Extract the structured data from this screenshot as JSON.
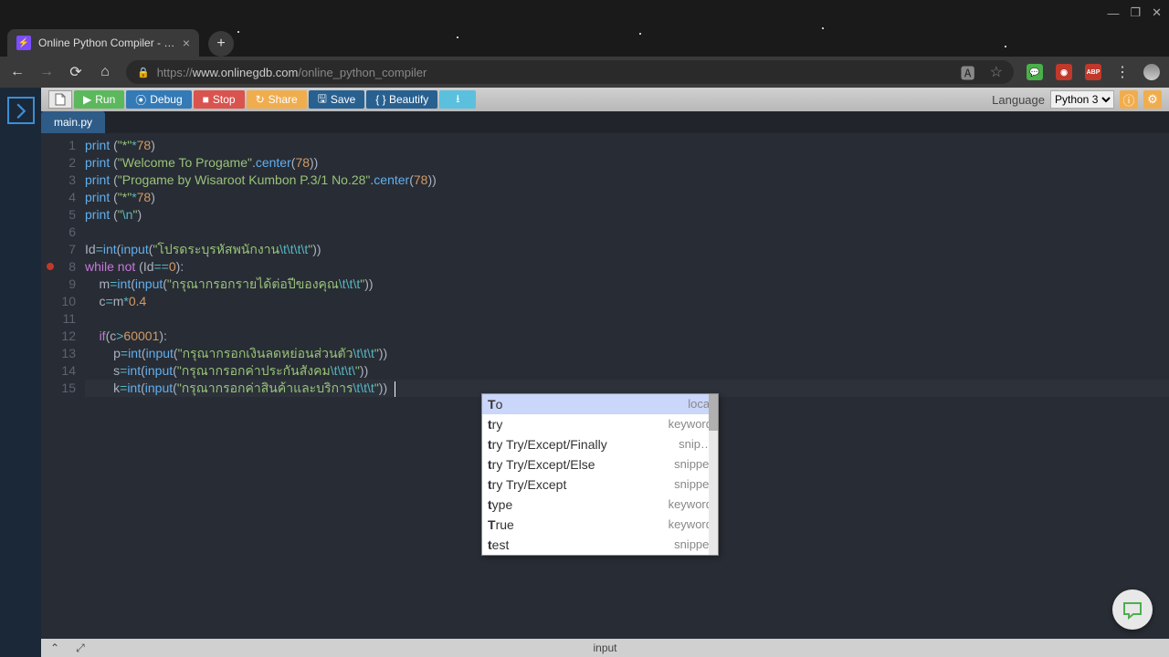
{
  "browser": {
    "tab_title": "Online Python Compiler - online…",
    "url_scheme": "https://",
    "url_host": "www.onlinegdb.com",
    "url_path": "/online_python_compiler"
  },
  "toolbar": {
    "file_icon": "▢",
    "run": "Run",
    "debug": "Debug",
    "stop": "Stop",
    "share": "Share",
    "save": "Save",
    "beautify": "{ } Beautify",
    "language_label": "Language",
    "language_value": "Python 3"
  },
  "filetab": "main.py",
  "code": {
    "lines": [
      [
        [
          "fn",
          "print"
        ],
        [
          "id",
          " ("
        ],
        [
          "str",
          "\"*\""
        ],
        [
          "op",
          "*"
        ],
        [
          "num",
          "78"
        ],
        [
          "id",
          ")"
        ]
      ],
      [
        [
          "fn",
          "print"
        ],
        [
          "id",
          " ("
        ],
        [
          "str",
          "\"Welcome To Progame\""
        ],
        [
          "id",
          "."
        ],
        [
          "fn",
          "center"
        ],
        [
          "id",
          "("
        ],
        [
          "num",
          "78"
        ],
        [
          "id",
          "))"
        ]
      ],
      [
        [
          "fn",
          "print"
        ],
        [
          "id",
          " ("
        ],
        [
          "str",
          "\"Progame by Wisaroot Kumbon P.3/1 No.28\""
        ],
        [
          "id",
          "."
        ],
        [
          "fn",
          "center"
        ],
        [
          "id",
          "("
        ],
        [
          "num",
          "78"
        ],
        [
          "id",
          "))"
        ]
      ],
      [
        [
          "fn",
          "print"
        ],
        [
          "id",
          " ("
        ],
        [
          "str",
          "\"*\""
        ],
        [
          "op",
          "*"
        ],
        [
          "num",
          "78"
        ],
        [
          "id",
          ")"
        ]
      ],
      [
        [
          "fn",
          "print"
        ],
        [
          "id",
          " ("
        ],
        [
          "str",
          "\""
        ],
        [
          "esc",
          "\\n"
        ],
        [
          "str",
          "\""
        ],
        [
          "id",
          ")"
        ]
      ],
      [],
      [
        [
          "id",
          "Id"
        ],
        [
          "op",
          "="
        ],
        [
          "fn",
          "int"
        ],
        [
          "id",
          "("
        ],
        [
          "fn",
          "input"
        ],
        [
          "id",
          "("
        ],
        [
          "str",
          "\"โปรดระบุรหัสพนักงาน"
        ],
        [
          "esc",
          "\\t\\t\\t\\t"
        ],
        [
          "str",
          "\""
        ],
        [
          "id",
          "))"
        ]
      ],
      [
        [
          "kw",
          "while"
        ],
        [
          "id",
          " "
        ],
        [
          "kw",
          "not"
        ],
        [
          "id",
          " (Id"
        ],
        [
          "op",
          "=="
        ],
        [
          "num",
          "0"
        ],
        [
          "id",
          "):"
        ]
      ],
      [
        [
          "id",
          "    m"
        ],
        [
          "op",
          "="
        ],
        [
          "fn",
          "int"
        ],
        [
          "id",
          "("
        ],
        [
          "fn",
          "input"
        ],
        [
          "id",
          "("
        ],
        [
          "str",
          "\"กรุณากรอกรายได้ต่อปีของคุณ"
        ],
        [
          "esc",
          "\\t\\t\\t"
        ],
        [
          "str",
          "\""
        ],
        [
          "id",
          "))"
        ]
      ],
      [
        [
          "id",
          "    c"
        ],
        [
          "op",
          "="
        ],
        [
          "id",
          "m"
        ],
        [
          "op",
          "*"
        ],
        [
          "num",
          "0.4"
        ]
      ],
      [],
      [
        [
          "id",
          "    "
        ],
        [
          "kw",
          "if"
        ],
        [
          "id",
          "(c"
        ],
        [
          "op",
          ">"
        ],
        [
          "num",
          "60001"
        ],
        [
          "id",
          "):"
        ]
      ],
      [
        [
          "id",
          "        p"
        ],
        [
          "op",
          "="
        ],
        [
          "fn",
          "int"
        ],
        [
          "id",
          "("
        ],
        [
          "fn",
          "input"
        ],
        [
          "id",
          "("
        ],
        [
          "str",
          "\"กรุณากรอกเงินลดหย่อนส่วนตัว"
        ],
        [
          "esc",
          "\\t\\t\\t"
        ],
        [
          "str",
          "\""
        ],
        [
          "id",
          "))"
        ]
      ],
      [
        [
          "id",
          "        s"
        ],
        [
          "op",
          "="
        ],
        [
          "fn",
          "int"
        ],
        [
          "id",
          "("
        ],
        [
          "fn",
          "input"
        ],
        [
          "id",
          "("
        ],
        [
          "str",
          "\"กรุณากรอกค่าประกันสังคม"
        ],
        [
          "esc",
          "\\t\\t\\t\\"
        ],
        [
          "str",
          "\""
        ],
        [
          "id",
          "))"
        ]
      ],
      [
        [
          "id",
          "        k"
        ],
        [
          "op",
          "="
        ],
        [
          "fn",
          "int"
        ],
        [
          "id",
          "("
        ],
        [
          "fn",
          "input"
        ],
        [
          "id",
          "("
        ],
        [
          "str",
          "\"กรุณากรอกค่าสินค้าและบริการ"
        ],
        [
          "esc",
          "\\t\\t\\t"
        ],
        [
          "str",
          "\""
        ],
        [
          "id",
          "))  "
        ]
      ]
    ],
    "current_line": 15,
    "error_line": 8
  },
  "autocomplete": {
    "items": [
      {
        "prefix": "T",
        "rest": "o",
        "meta": "local",
        "selected": true
      },
      {
        "prefix": "t",
        "rest": "ry",
        "meta": "keyword"
      },
      {
        "prefix": "t",
        "rest": "ry Try/Except/Finally",
        "meta": "snip…"
      },
      {
        "prefix": "t",
        "rest": "ry Try/Except/Else",
        "meta": "snippet"
      },
      {
        "prefix": "t",
        "rest": "ry Try/Except",
        "meta": "snippet"
      },
      {
        "prefix": "t",
        "rest": "ype",
        "meta": "keyword"
      },
      {
        "prefix": "T",
        "rest": "rue",
        "meta": "keyword"
      },
      {
        "prefix": "t",
        "rest": "est",
        "meta": "snippet"
      }
    ]
  },
  "bottombar": {
    "label": "input"
  }
}
